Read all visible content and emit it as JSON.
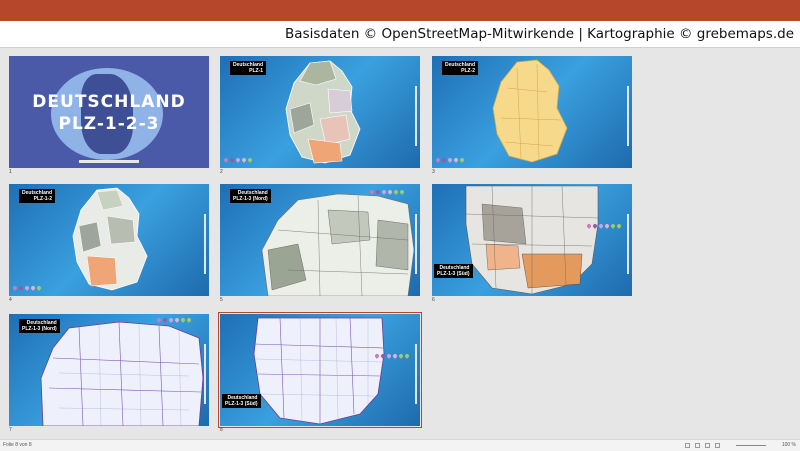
{
  "credit_text": "Basisdaten ©  OpenStreetMap-Mitwirkende | Kartographie © grebemaps.de",
  "title_slide": {
    "line1": "DEUTSCHLAND",
    "line2": "PLZ-1-2-3"
  },
  "slides": [
    {
      "num": "1"
    },
    {
      "num": "2",
      "label1": "Deutschland",
      "label2": "PLZ-1"
    },
    {
      "num": "3",
      "label1": "Deutschland",
      "label2": "PLZ-2"
    },
    {
      "num": "4",
      "label1": "Deutschland",
      "label2": "PLZ-1-2"
    },
    {
      "num": "5",
      "label1": "Deutschland",
      "label2": "PLZ-1-3 (Nord)"
    },
    {
      "num": "6",
      "label1": "Deutschland",
      "label2": "PLZ-1-3 (Süd)"
    },
    {
      "num": "7",
      "label1": "Deutschland",
      "label2": "PLZ-1-3 (Nord)"
    },
    {
      "num": "8",
      "label1": "Deutschland",
      "label2": "PLZ-1-3 (Süd)"
    }
  ],
  "status": {
    "left": "Folie 8 von 8",
    "zoom": "100 %"
  },
  "colors": {
    "accent": "#b7472a",
    "slide_blue": "#2f86cf",
    "title_bg": "#4a5aa8"
  }
}
